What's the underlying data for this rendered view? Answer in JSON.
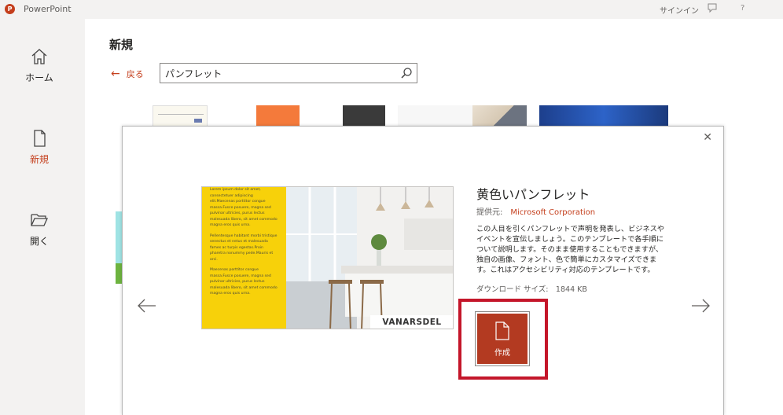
{
  "app": {
    "title": "PowerPoint",
    "logo_letter": "P"
  },
  "titlebar": {
    "signin": "サインイン",
    "help": "?"
  },
  "nav": {
    "home": "ホーム",
    "new": "新規",
    "open": "開く"
  },
  "page": {
    "title": "新規",
    "back": "戻る",
    "search_value": "パンフレット"
  },
  "preview": {
    "paragraphs": [
      "Lorem ipsum dolor sit amet, consectetuer adipiscing elit.Maecenas porttitor congue massa.Fusce posuere, magna sed pulvinar ultricies, purus lectus malesuada libero, sit amet commodo magna eros quis urna.",
      "Pellentesque habitant morbi tristique senectus et netus et malesuada fames ac turpis egestas.Proin pharetra nonummy pede.Mauris et orci.",
      "Maecenas porttitor congue massa.Fusce posuere, magna sed pulvinar ultricies, purus lectus malesuada libero, sit amet commodo magna eros quis urna."
    ],
    "brand": "VANARSDEL"
  },
  "template": {
    "title": "黄色いパンフレット",
    "provider_label": "提供元:",
    "provider": "Microsoft Corporation",
    "description": "この人目を引くパンフレットで声明を発表し、ビジネスやイベントを宣伝しましょう。このテンプレートで各手順について説明します。そのまま使用することもできますが、独自の画像、フォント、色で簡単にカスタマイズできます。これはアクセシビリティ対応のテンプレートです。",
    "download_size": "ダウンロード サイズ:　1844 KB",
    "create_label": "作成"
  },
  "colors": {
    "accent": "#c43e1c",
    "create_button": "#b33a21",
    "highlight_border": "#c4162a",
    "brochure_yellow": "#f7d10a"
  }
}
